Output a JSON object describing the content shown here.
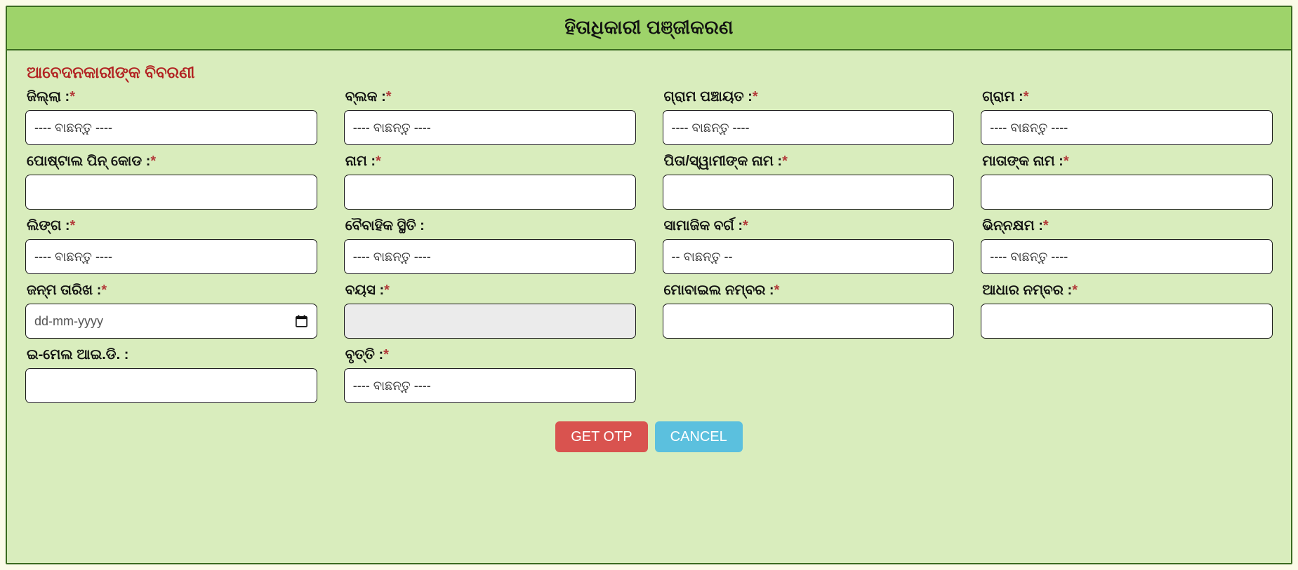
{
  "header": {
    "title": "ହିତାଧିକାରୀ ପଞ୍ଜୀକରଣ"
  },
  "section": {
    "title": "ଆବେଦନକାରୀଙ୍କ ବିବରଣୀ"
  },
  "placeholders": {
    "select4": "---- ବାଛନ୍ତୁ ----",
    "select2": "-- ବାଛନ୍ତୁ --",
    "date": "dd-mm-yyyy",
    "empty": ""
  },
  "required_mark": "*",
  "fields": [
    {
      "label": "ଜିଲ୍ଲା :",
      "required": true,
      "type": "select",
      "value": "---- ବାଛନ୍ତୁ ----",
      "name": "district"
    },
    {
      "label": "ବ୍ଲକ :",
      "required": true,
      "type": "select",
      "value": "---- ବାଛନ୍ତୁ ----",
      "name": "block"
    },
    {
      "label": "ଗ୍ରାମ ପଞ୍ଚାୟତ :",
      "required": true,
      "type": "select",
      "value": "---- ବାଛନ୍ତୁ ----",
      "name": "gram-panchayat"
    },
    {
      "label": "ଗ୍ରାମ :",
      "required": true,
      "type": "select",
      "value": "---- ବାଛନ୍ତୁ ----",
      "name": "village"
    },
    {
      "label": "ପୋଷ୍ଟାଲ ପିନ୍ କୋଡ :",
      "required": true,
      "type": "text",
      "value": "",
      "name": "postal-pin-code"
    },
    {
      "label": "ନାମ :",
      "required": true,
      "type": "text",
      "value": "",
      "name": "name"
    },
    {
      "label": "ପିତା/ସ୍ୱାମୀଙ୍କ ନାମ :",
      "required": true,
      "type": "text",
      "value": "",
      "name": "father-husband-name"
    },
    {
      "label": "ମାତାଙ୍କ ନାମ :",
      "required": true,
      "type": "text",
      "value": "",
      "name": "mother-name"
    },
    {
      "label": "ଲିଙ୍ଗ :",
      "required": true,
      "type": "select",
      "value": "---- ବାଛନ୍ତୁ ----",
      "name": "gender"
    },
    {
      "label": "ବୈବାହିକ ସ୍ଥିତି :",
      "required": false,
      "type": "select",
      "value": "---- ବାଛନ୍ତୁ ----",
      "name": "marital-status"
    },
    {
      "label": "ସାମାଜିକ ବର୍ଗ :",
      "required": true,
      "type": "select",
      "value": "-- ବାଛନ୍ତୁ --",
      "name": "social-category"
    },
    {
      "label": "ଭିନ୍ନକ୍ଷମ :",
      "required": true,
      "type": "select",
      "value": "---- ବାଛନ୍ତୁ ----",
      "name": "differently-abled"
    },
    {
      "label": "ଜନ୍ମ ତାରିଖ :",
      "required": true,
      "type": "date",
      "value": "dd-mm-yyyy",
      "name": "date-of-birth"
    },
    {
      "label": "ବୟସ :",
      "required": true,
      "type": "disabled",
      "value": "",
      "name": "age"
    },
    {
      "label": "ମୋବାଇଲ ନମ୍ବର :",
      "required": true,
      "type": "text",
      "value": "",
      "name": "mobile-number"
    },
    {
      "label": "ଆଧାର ନମ୍ବର :",
      "required": true,
      "type": "text",
      "value": "",
      "name": "aadhaar-number"
    },
    {
      "label": "ଇ-ମେଲ ଆଇ.ଡି. :",
      "required": false,
      "type": "text",
      "value": "",
      "name": "email-id"
    },
    {
      "label": "ବୃତ୍ତି :",
      "required": true,
      "type": "select",
      "value": "---- ବାଛନ୍ତୁ ----",
      "name": "occupation"
    }
  ],
  "actions": {
    "get_otp_label": "GET OTP",
    "cancel_label": "CANCEL"
  },
  "colors": {
    "header_bg": "#9ed36a",
    "body_bg": "#d9edbd",
    "border": "#3a6b1f",
    "section_title": "#b22222",
    "get_otp": "#d9534f",
    "cancel": "#5bc0de",
    "disabled_field": "#ebebeb"
  }
}
